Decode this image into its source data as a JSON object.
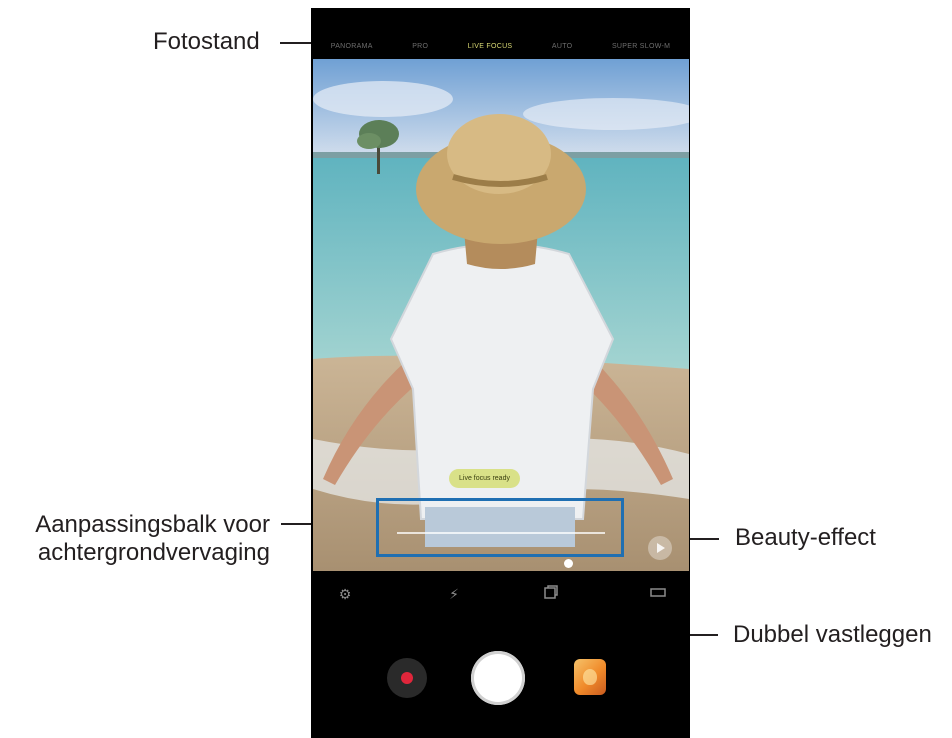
{
  "callouts": {
    "fotostand": "Fotostand",
    "aanpassingsbalk_line1": "Aanpassingsbalk voor",
    "aanpassingsbalk_line2": "achtergrondvervaging",
    "beauty_effect": "Beauty-effect",
    "dubbel_vastleggen": "Dubbel vastleggen"
  },
  "camera": {
    "modes": [
      {
        "label": "PANORAMA",
        "active": false
      },
      {
        "label": "PRO",
        "active": false
      },
      {
        "label": "LIVE FOCUS",
        "active": true
      },
      {
        "label": "AUTO",
        "active": false
      },
      {
        "label": "SUPER SLOW-M",
        "active": false
      }
    ],
    "live_focus_label": "Live focus ready",
    "blur_level": 0.82,
    "toolbar_icons": [
      "settings-icon",
      "flash-icon",
      "dual-capture-icon",
      "aspect-ratio-icon"
    ],
    "bottom_controls": [
      "record-button",
      "shutter-button",
      "gallery-thumbnail"
    ]
  },
  "colors": {
    "callout_text": "#231f20",
    "highlight_box": "#1f6fb2",
    "active_mode": "#d8d873",
    "record": "#e0263b"
  }
}
